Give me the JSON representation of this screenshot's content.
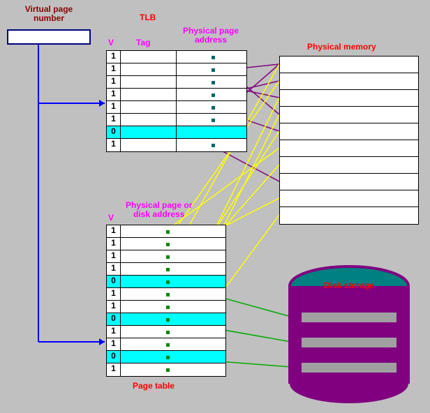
{
  "labels": {
    "virtual_page_number_l1": "Virtual page",
    "virtual_page_number_l2": "number",
    "tlb_title": "TLB",
    "v_header_tlb": "V",
    "tag_header": "Tag",
    "ppa_header_l1": "Physical page",
    "ppa_header_l2": "address",
    "physical_memory": "Physical memory",
    "v_header_pt": "V",
    "pt_header_l1": "Physical page or",
    "pt_header_l2": "disk address",
    "page_table": "Page  table",
    "disk_storage": "Disk storage"
  },
  "tlb_rows": [
    {
      "v": "1",
      "cls": ""
    },
    {
      "v": "1",
      "cls": ""
    },
    {
      "v": "1",
      "cls": ""
    },
    {
      "v": "1",
      "cls": ""
    },
    {
      "v": "1",
      "cls": ""
    },
    {
      "v": "1",
      "cls": ""
    },
    {
      "v": "0",
      "cls": "valid0"
    },
    {
      "v": "1",
      "cls": ""
    }
  ],
  "pt_rows": [
    {
      "v": "1",
      "cls": ""
    },
    {
      "v": "1",
      "cls": ""
    },
    {
      "v": "1",
      "cls": ""
    },
    {
      "v": "1",
      "cls": ""
    },
    {
      "v": "0",
      "cls": "valid0"
    },
    {
      "v": "1",
      "cls": ""
    },
    {
      "v": "1",
      "cls": ""
    },
    {
      "v": "0",
      "cls": "valid0"
    },
    {
      "v": "1",
      "cls": ""
    },
    {
      "v": "1",
      "cls": ""
    },
    {
      "v": "0",
      "cls": "valid0"
    },
    {
      "v": "1",
      "cls": ""
    }
  ],
  "pm_rows": 10,
  "disk_platters": 3,
  "chart_data": {
    "type": "table",
    "title": "TLB / Page table / Physical memory / Disk storage diagram",
    "components": [
      {
        "name": "TLB",
        "columns": [
          "V",
          "Tag",
          "Physical page address"
        ],
        "valid_bits": [
          1,
          1,
          1,
          1,
          1,
          1,
          0,
          1
        ]
      },
      {
        "name": "Page table",
        "columns": [
          "V",
          "Physical page or disk address"
        ],
        "valid_bits": [
          1,
          1,
          1,
          1,
          0,
          1,
          1,
          0,
          1,
          1,
          0,
          1
        ]
      },
      {
        "name": "Physical memory",
        "rows": 10
      },
      {
        "name": "Disk storage",
        "platters": 3
      }
    ],
    "mappings_description": "Virtual page number indexes both TLB and Page table. Valid TLB entries (purple arrows) map to physical memory frames. Page table entries with V=1 (yellow arrows) map to physical memory frames; entries with V=0 (green arrows) map to disk storage."
  }
}
